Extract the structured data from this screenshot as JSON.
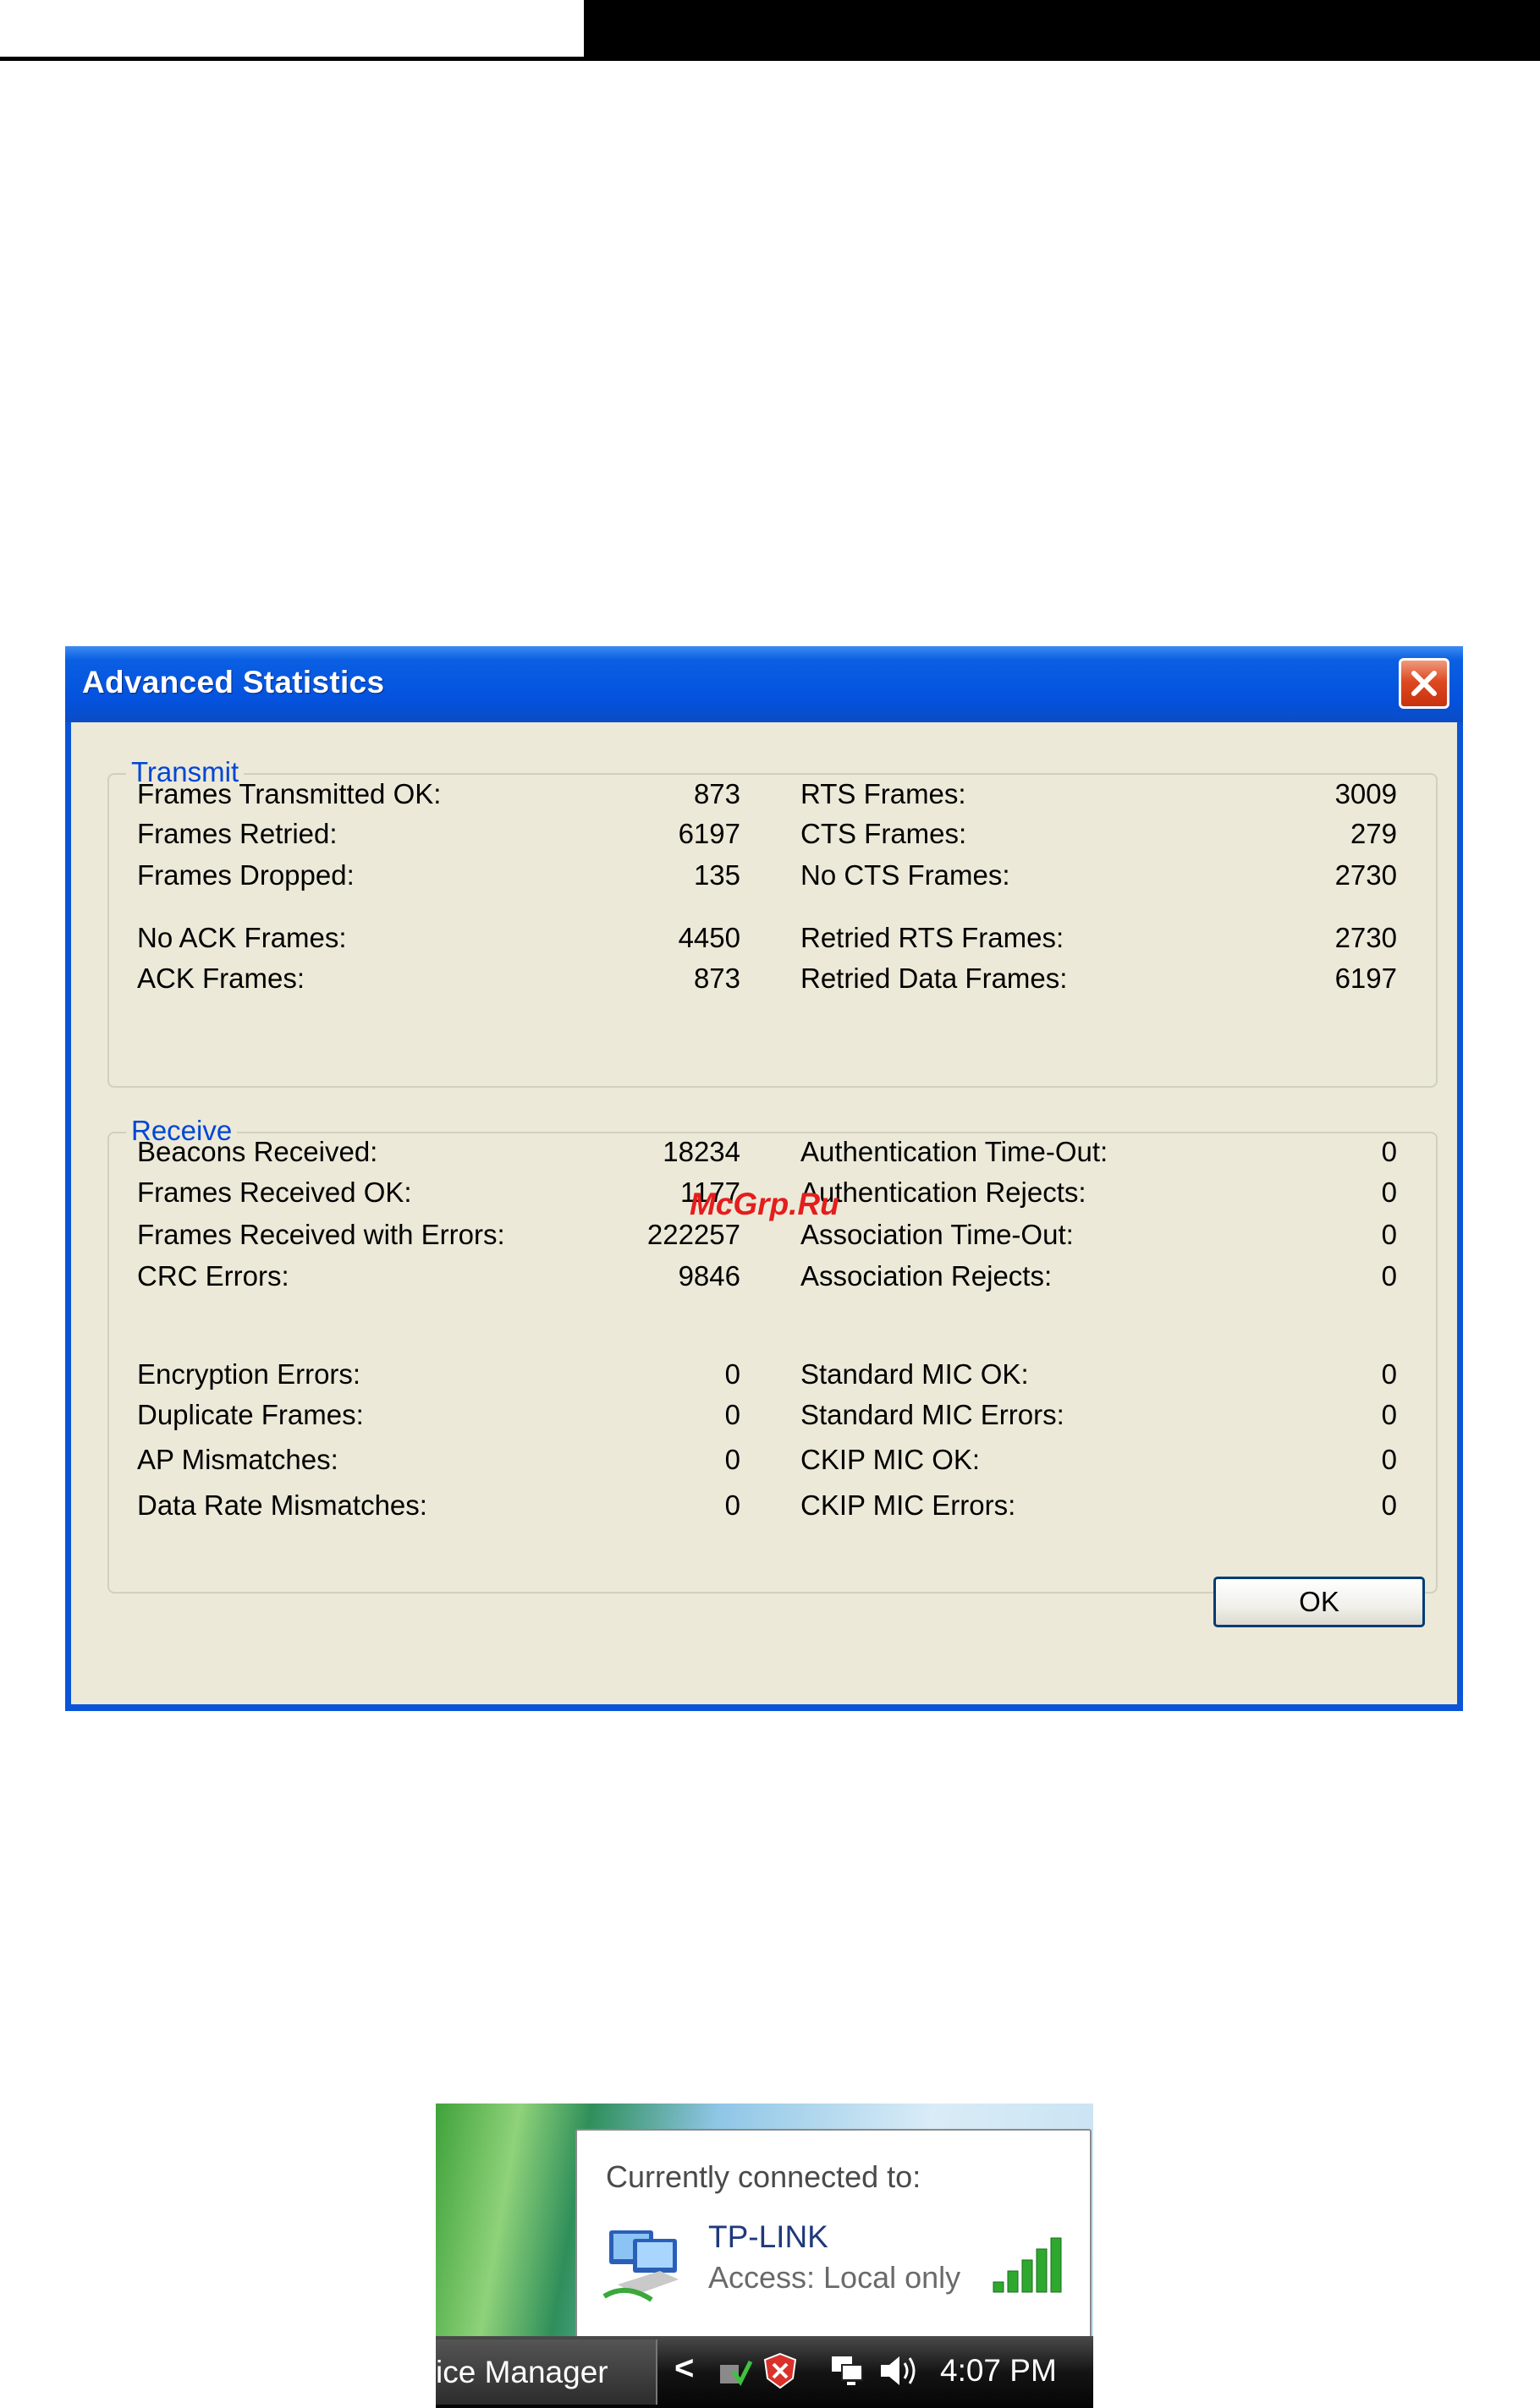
{
  "dialog": {
    "title": "Advanced Statistics",
    "ok_label": "OK",
    "transmit": {
      "legend": "Transmit",
      "left": [
        {
          "label": "Frames Transmitted OK:",
          "value": "873"
        },
        {
          "label": "Frames Retried:",
          "value": "6197"
        },
        {
          "label": "Frames Dropped:",
          "value": "135"
        },
        {
          "label": "No ACK Frames:",
          "value": "4450"
        },
        {
          "label": "ACK Frames:",
          "value": "873"
        }
      ],
      "right": [
        {
          "label": "RTS Frames:",
          "value": "3009"
        },
        {
          "label": "CTS Frames:",
          "value": "279"
        },
        {
          "label": "No CTS Frames:",
          "value": "2730"
        },
        {
          "label": "Retried RTS Frames:",
          "value": "2730"
        },
        {
          "label": "Retried Data Frames:",
          "value": "6197"
        }
      ]
    },
    "receive": {
      "legend": "Receive",
      "left": [
        {
          "label": "Beacons Received:",
          "value": "18234"
        },
        {
          "label": "Frames Received OK:",
          "value": "1177"
        },
        {
          "label": "Frames Received with Errors:",
          "value": "222257"
        },
        {
          "label": "CRC Errors:",
          "value": "9846"
        },
        {
          "label": "Encryption Errors:",
          "value": "0"
        },
        {
          "label": "Duplicate Frames:",
          "value": "0"
        },
        {
          "label": "AP Mismatches:",
          "value": "0"
        },
        {
          "label": "Data Rate Mismatches:",
          "value": "0"
        }
      ],
      "right": [
        {
          "label": "Authentication Time-Out:",
          "value": "0"
        },
        {
          "label": "Authentication Rejects:",
          "value": "0"
        },
        {
          "label": "Association Time-Out:",
          "value": "0"
        },
        {
          "label": "Association Rejects:",
          "value": "0"
        },
        {
          "label": "Standard MIC OK:",
          "value": "0"
        },
        {
          "label": "Standard MIC Errors:",
          "value": "0"
        },
        {
          "label": "CKIP MIC OK:",
          "value": "0"
        },
        {
          "label": "CKIP MIC Errors:",
          "value": "0"
        }
      ]
    }
  },
  "watermark": "McGrp.Ru",
  "tray": {
    "heading": "Currently connected to:",
    "network_name": "TP-LINK",
    "access": "Access:  Local only",
    "taskbar_item": "ice Manager",
    "chevron": "<",
    "clock": "4:07 PM",
    "signal_bars": 5,
    "icons": [
      "network-icon",
      "signal-strength-icon",
      "safely-remove-icon",
      "security-alert-icon",
      "network-tray-icon",
      "volume-icon"
    ]
  }
}
